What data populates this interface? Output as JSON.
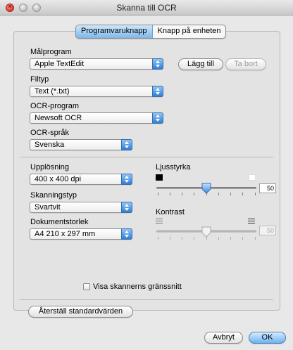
{
  "window": {
    "title": "Skanna till OCR"
  },
  "tabs": [
    {
      "label": "Programvaruknapp",
      "selected": true
    },
    {
      "label": "Knapp på enheten",
      "selected": false
    }
  ],
  "target_app": {
    "label": "Målprogram",
    "value": "Apple TextEdit",
    "add_button": "Lägg till",
    "remove_button": "Ta bort"
  },
  "file_type": {
    "label": "Filtyp",
    "value": "Text (*.txt)"
  },
  "ocr_program": {
    "label": "OCR-program",
    "value": "Newsoft OCR"
  },
  "ocr_language": {
    "label": "OCR-språk",
    "value": "Svenska"
  },
  "resolution": {
    "label": "Upplösning",
    "value": "400 x 400 dpi"
  },
  "scan_type": {
    "label": "Skanningstyp",
    "value": "Svartvit"
  },
  "document_size": {
    "label": "Dokumentstorlek",
    "value": "A4  210 x 297 mm"
  },
  "brightness": {
    "label": "Ljusstyrka",
    "value": "50",
    "level": 0.5
  },
  "contrast": {
    "label": "Kontrast",
    "value": "50",
    "level": 0.5,
    "enabled": false
  },
  "show_scanner_ui": {
    "label": "Visa skannerns gränssnitt",
    "checked": false
  },
  "restore_defaults_button": "Återställ standardvärden",
  "cancel_button": "Avbryt",
  "ok_button": "OK"
}
